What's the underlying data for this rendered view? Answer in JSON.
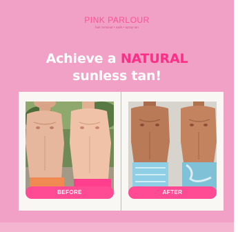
{
  "brand": {
    "name": "PINK PARLOUR",
    "tagline": "hair removal • nails • spray tan"
  },
  "headline": {
    "part1": "Achieve a ",
    "accent": "NATURAL",
    "line2": "sunless tan!"
  },
  "panels": {
    "before_label": "BEFORE",
    "after_label": "AFTER"
  },
  "colors": {
    "background": "#f1a1c6",
    "accent": "#ff2e86",
    "pill": "#ff4b93",
    "panel": "#f9f7f4"
  }
}
